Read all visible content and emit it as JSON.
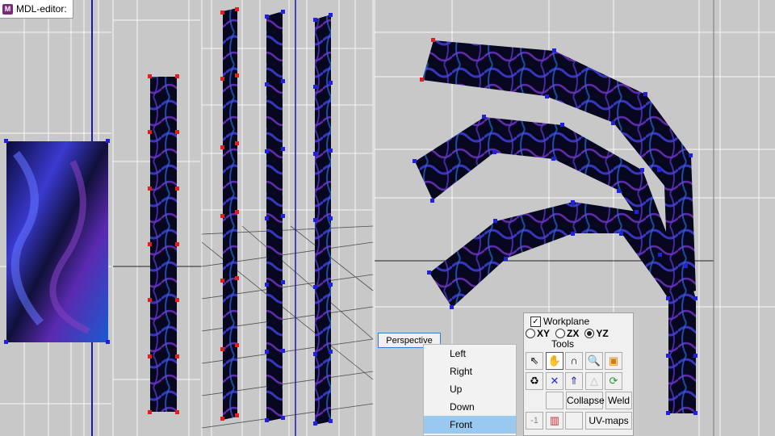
{
  "app": {
    "title": "MDL-editor:"
  },
  "viewport": {
    "view_button": "Perspective"
  },
  "view_menu": {
    "items": [
      "Left",
      "Right",
      "Up",
      "Down",
      "Front"
    ],
    "selected": "Front"
  },
  "tools_panel": {
    "workplane_label": "Workplane",
    "workplane_checked": true,
    "planes": [
      "XY",
      "ZX",
      "YZ"
    ],
    "selected_plane": "YZ",
    "tools_label": "Tools",
    "collapse_label": "Collapse",
    "weld_label": "Weld",
    "minus_one_label": "-1",
    "uvmaps_label": "UV-maps"
  },
  "colors": {
    "accent": "#99c9ef",
    "vertex_red": "#e02020",
    "vertex_blue": "#2020e0",
    "grid": "#ffffff",
    "axis": "#1a1aa8"
  }
}
